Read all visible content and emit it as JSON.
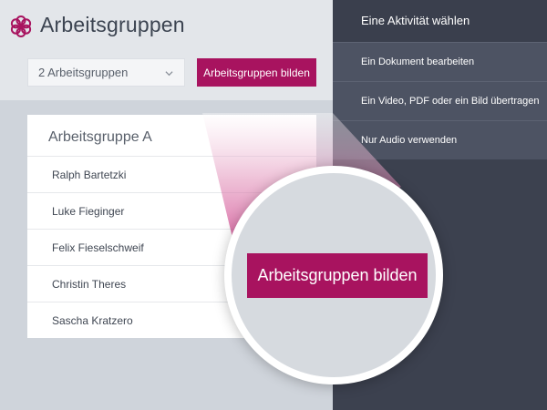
{
  "app": {
    "title": "Arbeitsgruppen",
    "group_select_value": "2 Arbeitsgruppen",
    "build_button_label": "Arbeitsgruppen bilden"
  },
  "group_card": {
    "title": "Arbeitsgruppe A",
    "members": [
      "Ralph Bartetzki",
      "Luke Fieginger",
      "Felix Fieselschweif",
      "Christin Theres",
      "Sascha Kratzero"
    ]
  },
  "activity_panel": {
    "title": "Eine Aktivität wählen",
    "items": [
      "Ein Dokument bearbeiten",
      "Ein Video, PDF oder ein Bild übertragen",
      "Nur Audio verwenden"
    ]
  },
  "magnifier": {
    "button_label": "Arbeitsgruppen bilden"
  },
  "colors": {
    "accent": "#a8135f",
    "panel_dark": "#3c414f",
    "panel_item": "#4d5363"
  },
  "icons": {
    "logo": "flower-logo-icon",
    "select": "chevron-down-icon"
  }
}
